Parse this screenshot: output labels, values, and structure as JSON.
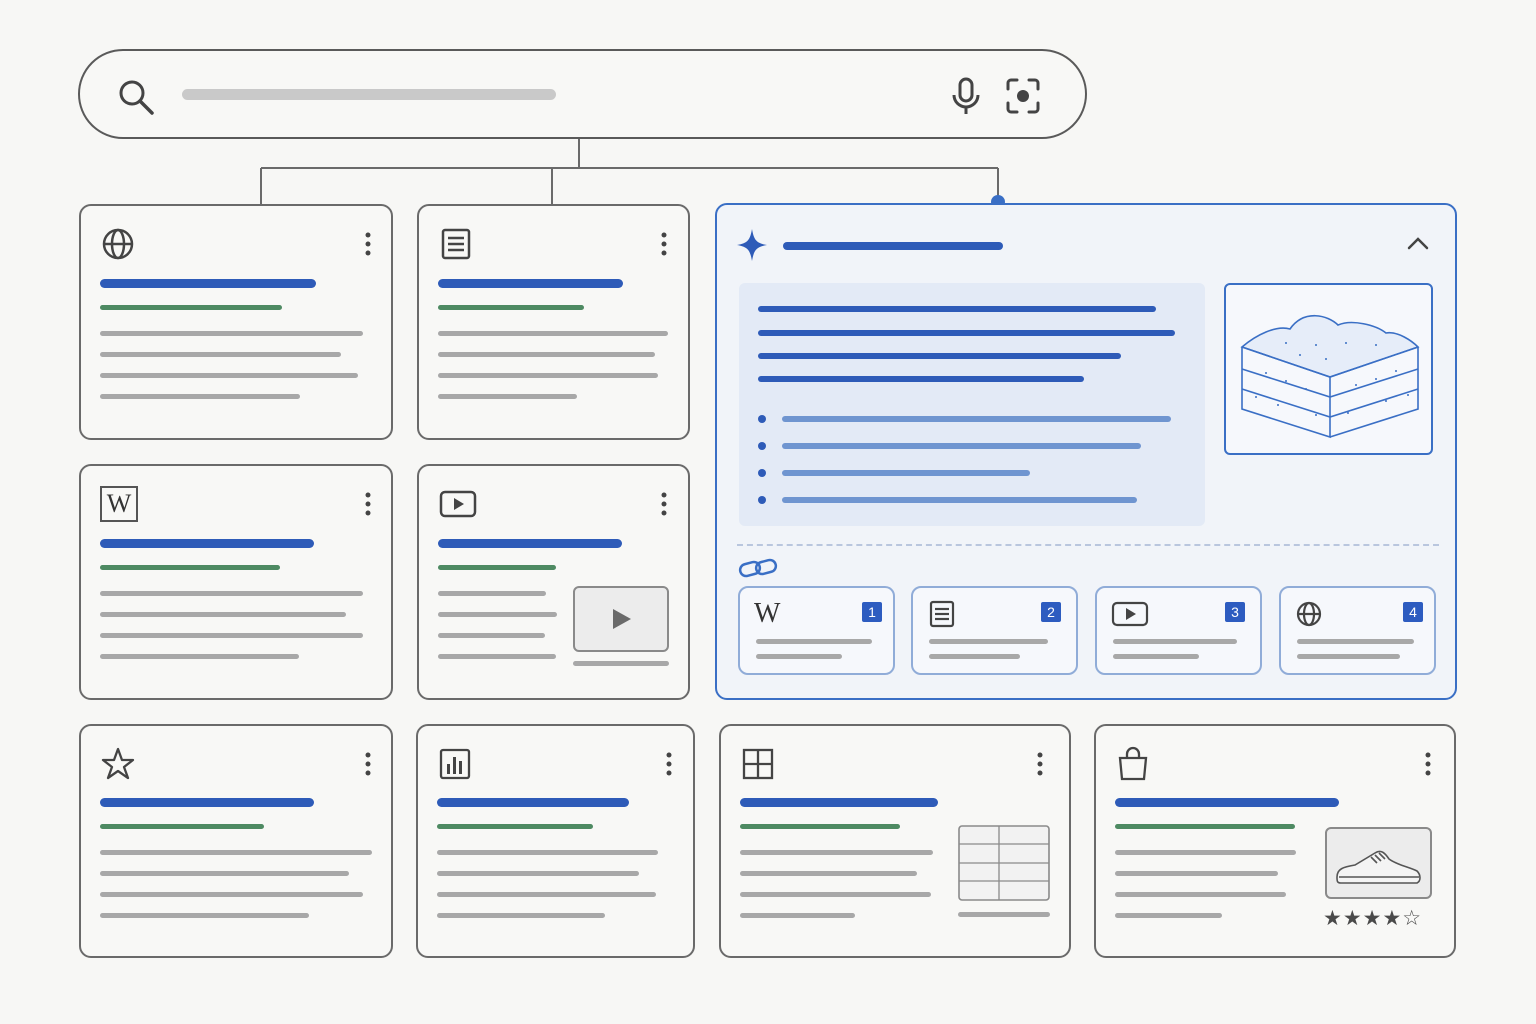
{
  "search": {
    "query": ""
  },
  "icons": {
    "search": "magnifier-icon",
    "mic": "microphone-icon",
    "lens": "camera-lens-icon",
    "web": "globe-icon",
    "article": "document-icon",
    "wiki": "wikipedia-icon",
    "video": "play-icon",
    "review": "star-icon",
    "chart": "bar-chart-icon",
    "table": "grid-icon",
    "shop": "shopping-bag-icon",
    "ai": "sparkle-icon",
    "collapse": "chevron-up-icon",
    "sources": "link-icon"
  },
  "cards": {
    "wiki": {
      "glyph": "W"
    }
  },
  "ai_overview": {
    "sources": [
      {
        "type": "wikipedia",
        "glyph": "W",
        "number": "1"
      },
      {
        "type": "document",
        "number": "2"
      },
      {
        "type": "video",
        "number": "3"
      },
      {
        "type": "web",
        "number": "4"
      }
    ]
  },
  "product": {
    "rating": 4,
    "rating_max": 5,
    "stars": "★★★★☆"
  },
  "colors": {
    "accent": "#2e5bb8",
    "url_green": "#4e8a62",
    "ai_border": "#3a6fc5"
  }
}
